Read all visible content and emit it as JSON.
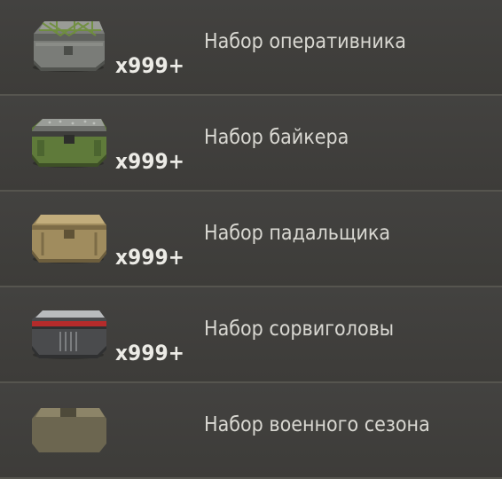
{
  "items": [
    {
      "icon": "operative-crate-icon",
      "quantity": "x999+",
      "label": "Набор оперативника"
    },
    {
      "icon": "biker-crate-icon",
      "quantity": "x999+",
      "label": "Набор байкера"
    },
    {
      "icon": "scavenger-crate-icon",
      "quantity": "x999+",
      "label": "Набор падальщика"
    },
    {
      "icon": "daredevil-crate-icon",
      "quantity": "x999+",
      "label": "Набор сорвиголовы"
    },
    {
      "icon": "military-crate-icon",
      "quantity": "",
      "label": "Набор военного сезона"
    }
  ]
}
